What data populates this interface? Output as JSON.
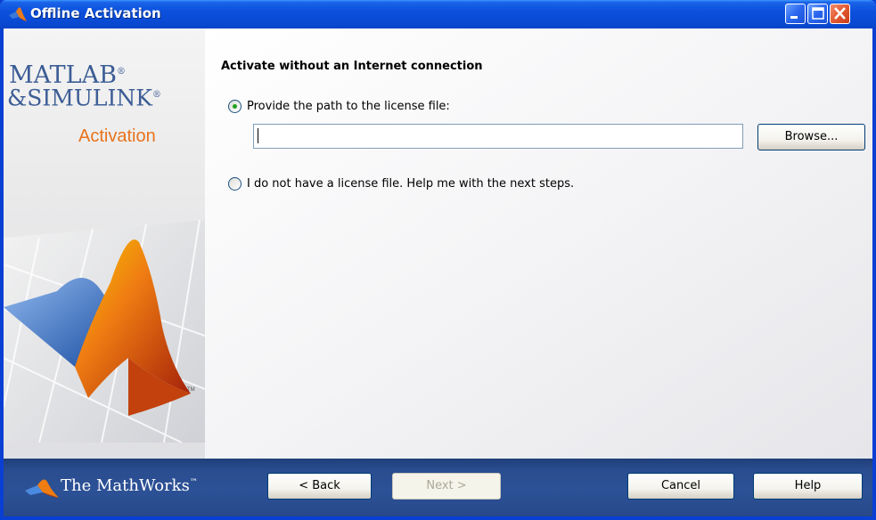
{
  "window": {
    "title": "Offline Activation",
    "buttons": [
      "minimize",
      "maximize",
      "close"
    ]
  },
  "branding": {
    "line1": "MATLAB",
    "line2": "&SIMULINK",
    "registered_mark": "®",
    "subtitle": "Activation",
    "trademark": "TM",
    "accent_color": "#e8731c"
  },
  "main": {
    "heading": "Activate without an Internet connection",
    "option_license_path": {
      "label": "Provide the path to the license file:",
      "selected": true
    },
    "license_path_value": "",
    "browse_label": "Browse...",
    "option_no_license": {
      "label": "I do not have a license file.  Help me with the next steps.",
      "selected": false
    }
  },
  "footer": {
    "company": "The MathWorks",
    "company_tm": "™",
    "back_label": "< Back",
    "next_label": "Next >",
    "cancel_label": "Cancel",
    "help_label": "Help",
    "background_color": "#2c5196"
  }
}
